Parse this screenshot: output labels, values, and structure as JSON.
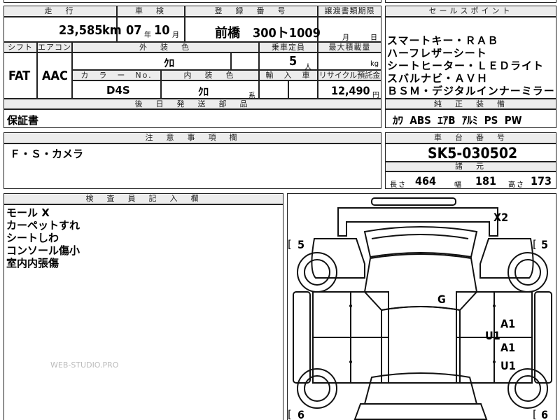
{
  "top_row": {
    "mileage_label": "走　行",
    "mileage_value": "23,585",
    "mileage_unit": "km",
    "inspection_label": "車　検",
    "inspection_year": "07",
    "year_unit": "年",
    "inspection_month": "10",
    "month_unit": "月",
    "registration_label": "登　録　番　号",
    "registration_value": "前橋　300ト1009",
    "transfer_label": "譲渡書類期限",
    "transfer_month_unit": "月",
    "transfer_day_unit": "日"
  },
  "second_row": {
    "shift_label": "シフト",
    "shift_value": "FAT",
    "aircon_label": "エアコン",
    "aircon_value": "AAC",
    "exterior_color_label": "外　装　色",
    "exterior_color_value": "ｸﾛ",
    "capacity_label": "乗車定員",
    "capacity_value": "5",
    "capacity_unit": "人",
    "max_load_label": "最大積載量",
    "max_load_unit": "kg",
    "color_no_label": "カ　ラ　ー　No.",
    "color_no_value": "D4S",
    "interior_color_label": "内　装　色",
    "interior_color_value": "ｸﾛ",
    "interior_suffix": "系",
    "import_label": "輸　入　車",
    "recycle_label": "リサイクル預託金",
    "recycle_value": "12,490",
    "recycle_unit": "円"
  },
  "sales_points": {
    "label": "セールスポイント",
    "lines": [
      "スマートキー・ＲＡＢ",
      "ハーフレザーシート",
      "シートヒーター・ＬＥＤライト",
      "スバルナビ・ＡＶＨ",
      "ＢＳＭ・デジタルインナーミラー"
    ]
  },
  "equipment": {
    "label": "純　正　装　備",
    "value": "ｶﾜ  ABS  ｴｱB  ｱﾙﾐ  PS  PW"
  },
  "parts": {
    "label": "後　日　発　送　部　品",
    "value": "保証書"
  },
  "notes": {
    "label": "注　意　事　項　欄",
    "value": "Ｆ・Ｓ・カメラ"
  },
  "chassis": {
    "label": "車　台　番　号",
    "value": "SK5-030502"
  },
  "dimensions": {
    "label": "諸　元",
    "length_label": "長さ",
    "length_value": "464",
    "width_label": "幅",
    "width_value": "181",
    "height_label": "高さ",
    "height_value": "173"
  },
  "inspector": {
    "label": "検　査　員　記　入　欄",
    "lines": [
      "モール X",
      "カーペットすれ",
      "シートしわ",
      "コンソール傷小",
      "室内内張傷"
    ]
  },
  "diagram": {
    "marks": [
      "X2",
      "G",
      "A1",
      "U1",
      "A1",
      "U1"
    ],
    "tire_front_left": "5",
    "tire_front_right": "5",
    "tire_rear_left": "6",
    "tire_rear_right": "6",
    "bracket_open": "[",
    "bracket_close": "]"
  },
  "watermark": "WEB-STUDIO.PRO"
}
